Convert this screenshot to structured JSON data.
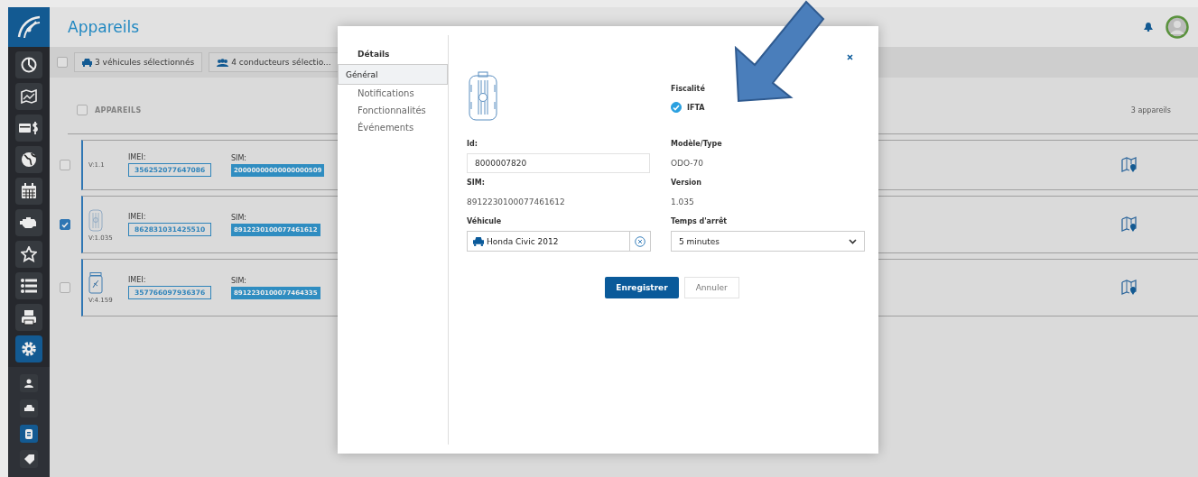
{
  "header": {
    "title": "Appareils"
  },
  "sidebar": {
    "items": [
      {
        "kind": "chart",
        "selected": false
      },
      {
        "kind": "map",
        "selected": false
      },
      {
        "kind": "money",
        "selected": false
      },
      {
        "kind": "globe",
        "selected": false
      },
      {
        "kind": "calendar",
        "selected": false
      },
      {
        "kind": "engine",
        "selected": false
      },
      {
        "kind": "star",
        "selected": false
      },
      {
        "kind": "list",
        "selected": false
      },
      {
        "kind": "printer",
        "selected": false
      },
      {
        "kind": "gear",
        "selected": true
      }
    ],
    "subitems": [
      {
        "kind": "user",
        "selected": false
      },
      {
        "kind": "car",
        "selected": false
      },
      {
        "kind": "device",
        "selected": true
      },
      {
        "kind": "tag",
        "selected": false
      }
    ]
  },
  "toolbar": {
    "checked": false,
    "chips": [
      {
        "kind": "vehicles",
        "label": "3 véhicules sélectionnés"
      },
      {
        "kind": "drivers",
        "label": "4 conducteurs sélectio..."
      }
    ]
  },
  "list": {
    "title": "APPAREILS",
    "checked": false,
    "count": "3 appareils",
    "rows": [
      {
        "kind": "none",
        "checked": false,
        "version": "V:1.1",
        "imei_label": "IMEI:",
        "imei": "356252077647086",
        "sim_label": "SIM:",
        "sim": "20000000000000000509"
      },
      {
        "kind": "box",
        "checked": true,
        "version": "V:1.035",
        "imei_label": "IMEI:",
        "imei": "862831031425510",
        "sim_label": "SIM:",
        "sim": "8912230100077461612"
      },
      {
        "kind": "jar",
        "checked": false,
        "version": "V:4.159",
        "imei_label": "IMEI:",
        "imei": "357766097936376",
        "sim_label": "SIM:",
        "sim": "8912230100077464335"
      }
    ]
  },
  "modal": {
    "nav_title": "Détails",
    "nav": [
      {
        "label": "Général",
        "selected": true
      },
      {
        "label": "Notifications",
        "selected": false
      },
      {
        "label": "Fonctionnalités",
        "selected": false
      },
      {
        "label": "Événements",
        "selected": false
      }
    ],
    "fiscal_label": "Fiscalité",
    "ifta": {
      "label": "IFTA",
      "checked": true
    },
    "id_label": "Id:",
    "id": "8000007820",
    "model_label": "Modèle/Type",
    "model": "ODO-70",
    "sim_label": "SIM:",
    "sim": "8912230100077461612",
    "version_label": "Version",
    "version": "1.035",
    "vehicle_label": "Véhicule",
    "vehicle": "Honda Civic 2012",
    "stop_label": "Temps d'arrêt",
    "stop": "5 minutes",
    "save": "Enregistrer",
    "cancel": "Annuler"
  }
}
